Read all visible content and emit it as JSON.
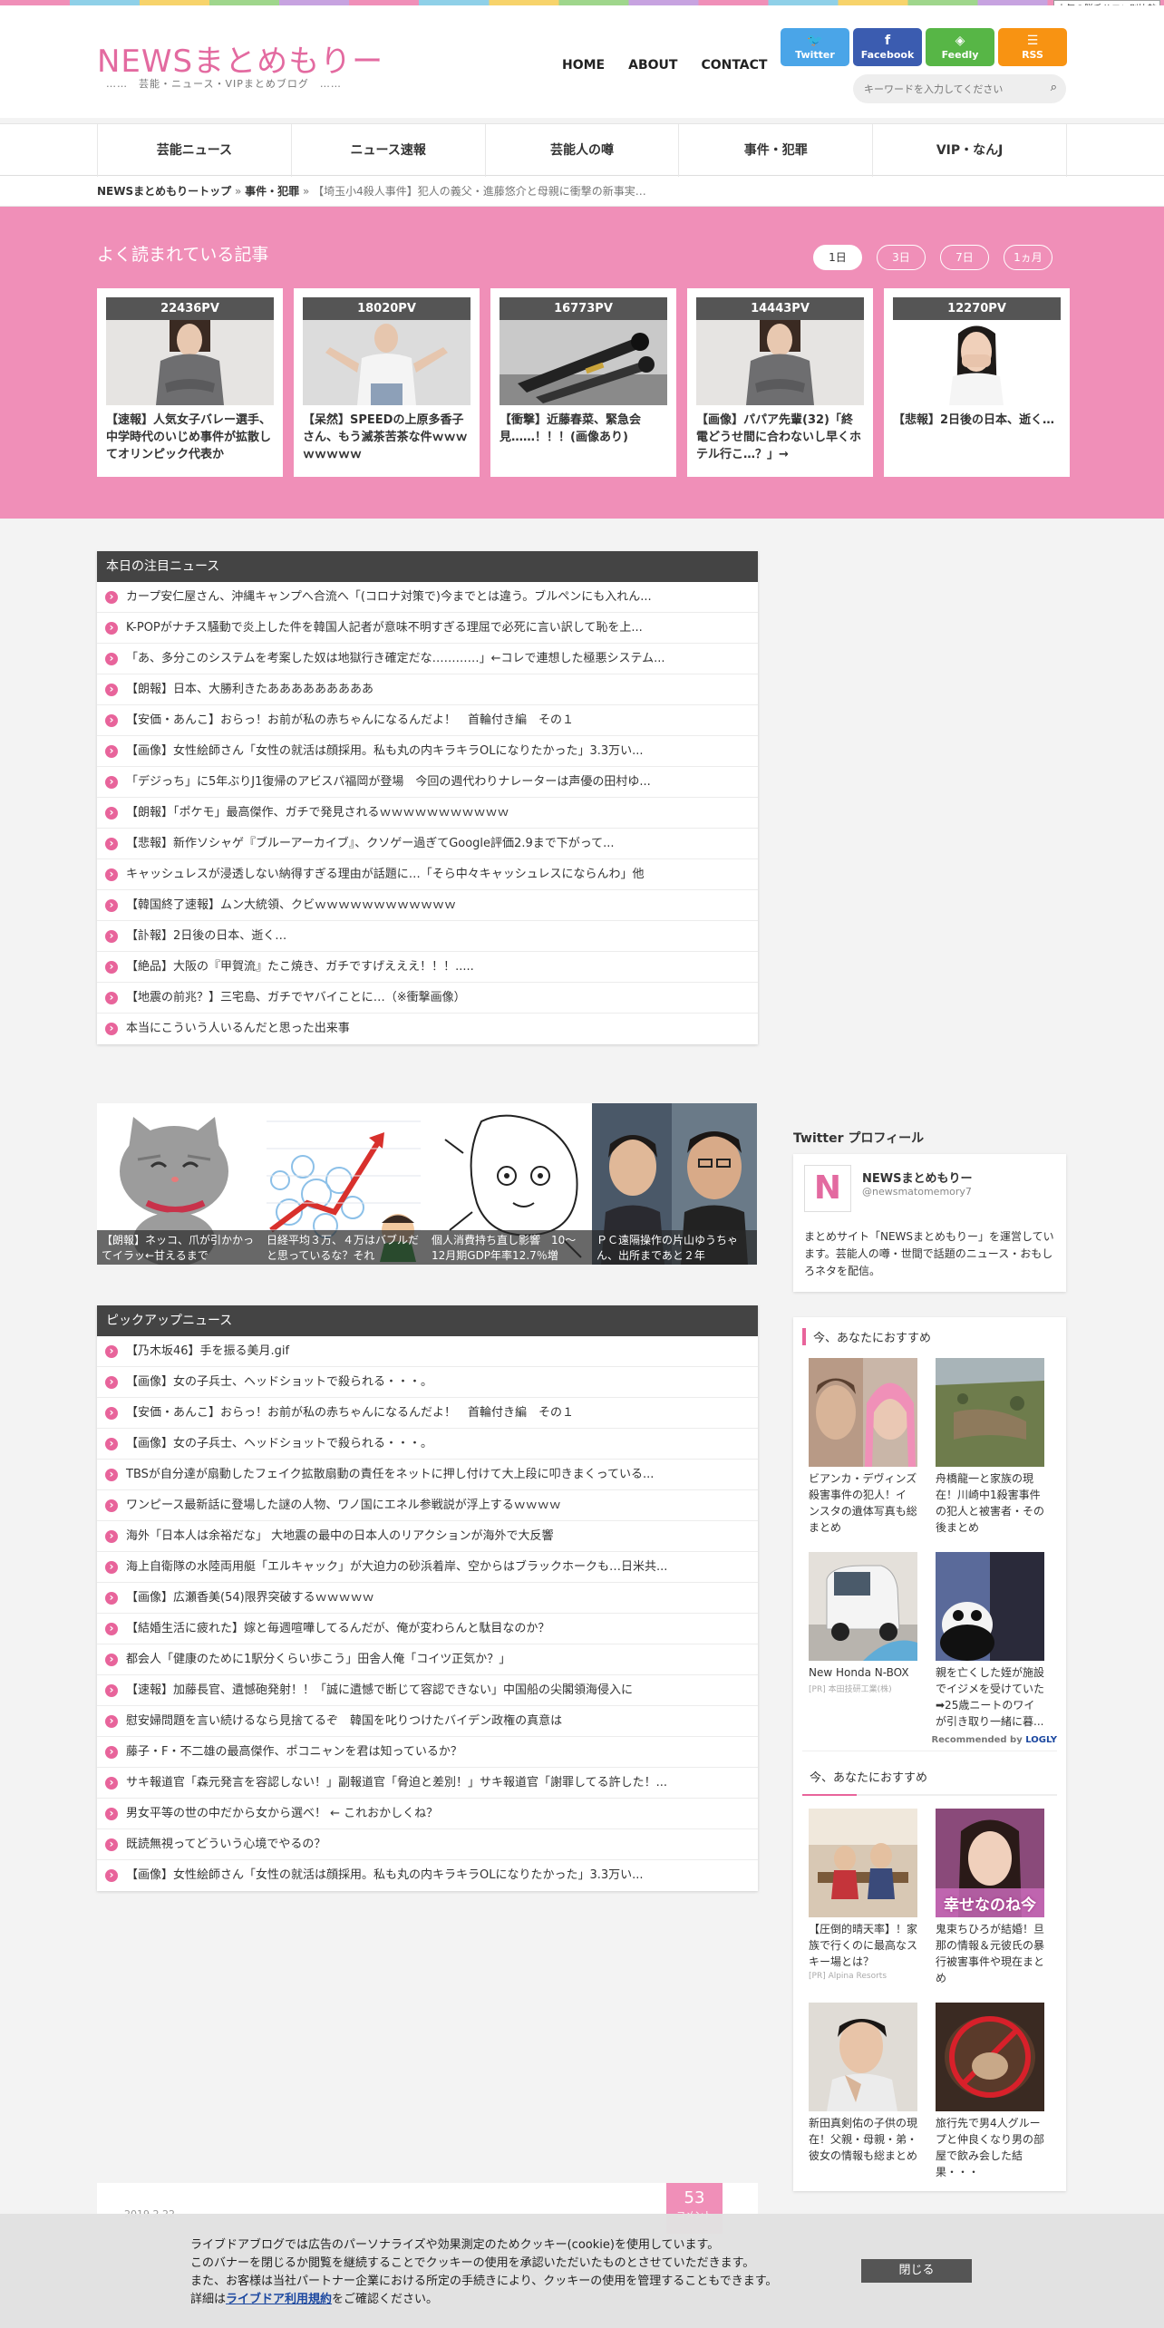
{
  "top_badge": "人気の脱毛サロン別比較",
  "site": {
    "logo": "NEWSまとめもりー",
    "tagline": "……　芸能・ニュース・VIPまとめブログ　……"
  },
  "nav": [
    "HOME",
    "ABOUT",
    "CONTACT"
  ],
  "social": [
    {
      "label": "Twitter",
      "icon": "twitter-icon",
      "glyph": "🐦",
      "color": "#4aa5e8"
    },
    {
      "label": "Facebook",
      "icon": "facebook-icon",
      "glyph": "f",
      "color": "#3b5cb0"
    },
    {
      "label": "Feedly",
      "icon": "feedly-icon",
      "glyph": "◈",
      "color": "#57b646"
    },
    {
      "label": "RSS",
      "icon": "rss-icon",
      "glyph": "☰",
      "color": "#f89312"
    }
  ],
  "search": {
    "placeholder": "キーワードを入力してください"
  },
  "categories": [
    "芸能ニュース",
    "ニュース速報",
    "芸能人の噂",
    "事件・犯罪",
    "VIP・なんJ"
  ],
  "breadcrumb": {
    "home": "NEWSまとめもりートップ",
    "sep": "»",
    "category": "事件・犯罪",
    "current": "【埼玉小4殺人事件】犯人の義父・進藤悠介と母親に衝撃の新事実…"
  },
  "ranking": {
    "title": "よく読まれている記事",
    "tabs": [
      "1日",
      "3日",
      "7日",
      "1ヵ月"
    ],
    "active_tab": 0,
    "cards": [
      {
        "pv": "22436PV",
        "title": "【速報】人気女子バレー選手、中学時代のいじめ事件が拡散してオリンピック代表か",
        "img": "woman"
      },
      {
        "pv": "18020PV",
        "title": "【呆然】SPEEDの上原多香子さん、もう滅茶苦茶な件ｗｗｗｗｗｗｗｗ",
        "img": "shrug"
      },
      {
        "pv": "16773PV",
        "title": "【衝撃】近藤春菜、緊急会見……！！！(画像あり)",
        "img": "mics"
      },
      {
        "pv": "14443PV",
        "title": "【画像】パパア先輩(32)「終電どうせ間に合わないし早くホテル行こ…？」→",
        "img": "woman"
      },
      {
        "pv": "12270PV",
        "title": "【悲報】2日後の日本、逝く…",
        "img": "shock"
      }
    ]
  },
  "today_news": {
    "title": "本日の注目ニュース",
    "items": [
      "カープ安仁屋さん、沖縄キャンプへ合流へ「(コロナ対策で)今までとは違う。ブルペンにも入れん...",
      "K-POPがナチス騒動で炎上した件を韓国人記者が意味不明すぎる理屈で必死に言い訳して恥を上...",
      "「あ、多分このシステムを考案した奴は地獄行き確定だな…………」←コレで連想した極悪システム...",
      "【朗報】日本、大勝利きたあああああああああ",
      "【安価・あんこ】おらっ！お前が私の赤ちゃんになるんだよ！　首輪付き編　その１",
      "【画像】女性絵師さん「女性の就活は顔採用。私も丸の内キラキラOLになりたかった」3.3万い...",
      "「デジっち」に5年ぶりJ1復帰のアビスパ福岡が登場　今回の週代わりナレーターは声優の田村ゆ...",
      "【朗報】「ポケモ」最高傑作、ガチで発見されるｗｗｗｗｗｗｗｗｗｗｗ",
      "【悲報】新作ソシャゲ『ブルーアーカイブ』、クソゲー過ぎてGoogle評価2.9まで下がって...",
      "キャッシュレスが浸透しない納得すぎる理由が話題に…「そら中々キャッシュレスにならんわ」他",
      "【韓国終了速報】ムン大統領、クビｗｗｗｗｗｗｗｗｗｗｗｗ",
      "【訃報】2日後の日本、逝く…",
      "【絶品】大阪の『甲賀流』たこ焼き、ガチですげえええ！！！.....",
      "【地震の前兆？】三宅島、ガチでヤバイことに…（※衝撃画像）",
      "本当にこういう人いるんだと思った出来事"
    ]
  },
  "gallery": [
    {
      "caption": "【朗報】ネッコ、爪が引かかってイラッ←甘えるまで",
      "img": "cat"
    },
    {
      "caption": "日経平均３万、４万はバブルだと思っているな？それ",
      "img": "chart"
    },
    {
      "caption": "個人消費持ち直し影響　10～12月期GDP年率12.7％増",
      "img": "aa"
    },
    {
      "caption": "ＰＣ遠隔操作の片山ゆうちゃん、出所まであと２年",
      "img": "men"
    }
  ],
  "pickup": {
    "title": "ピックアップニュース",
    "items": [
      "【乃木坂46】手を振る美月.gif",
      "【画像】女の子兵士、ヘッドショットで殺られる・・・。",
      "【安価・あんこ】おらっ！お前が私の赤ちゃんになるんだよ！　首輪付き編　その１",
      "【画像】女の子兵士、ヘッドショットで殺られる・・・。",
      "TBSが自分達が扇動したフェイク拡散扇動の責任をネットに押し付けて大上段に叩きまくっている...",
      "ワンピース最新話に登場した謎の人物、ワノ国にエネル参戦説が浮上するｗｗｗｗ",
      "海外「日本人は余裕だな」 大地震の最中の日本人のリアクションが海外で大反響",
      "海上自衛隊の水陸両用艇「エルキャック」が大迫力の砂浜着岸、空からはブラックホークも…日米共...",
      "【画像】広瀬香美(54)限界突破するｗｗｗｗｗ",
      "【結婚生活に疲れた】嫁と毎週喧嘩してるんだが、俺が変わらんと駄目なのか？",
      "都会人「健康のために1駅分くらい歩こう」田舎人俺「コイツ正気か？」",
      "【速報】加藤長官、遺憾砲発射！！「誠に遺憾で断じて容認できない」中国船の尖閣領海侵入に",
      "慰安婦問題を言い続けるなら見捨てるぞ　韓国を叱りつけたバイデン政権の真意は",
      "藤子・F・不二雄の最高傑作、ポコニャンを君は知っているか？",
      "サキ報道官「森元発言を容認しない！」副報道官「脅迫と差別！」サキ報道官「謝罪してる許した！...",
      "男女平等の世の中だから女から選べ！ ← これおかしくね？",
      "既読無視ってどういう心境でやるの？",
      "【画像】女性絵師さん「女性の就活は顔採用。私も丸の内キラキラOLになりたかった」3.3万い..."
    ]
  },
  "post_preview": {
    "date": "2019.2.22",
    "comment_count": "53",
    "comment_label": "コメント"
  },
  "twitter_profile": {
    "heading": "Twitter プロフィール",
    "avatar_letter": "N",
    "name": "NEWSまとめもりー",
    "handle": "@newsmatomemory7",
    "desc": "まとめサイト「NEWSまとめもりー」を運営しています。芸能人の噂・世間で話題のニュース・おもしろネタを配信。"
  },
  "recommend1": {
    "title": "今、あなたにおすすめ",
    "items": [
      {
        "title": "ビアンカ・デヴィンズ殺害事件の犯人！インスタの遺体写真も総まとめ",
        "src": "",
        "img": "faces"
      },
      {
        "title": "舟橋龍一と家族の現在！川崎中1殺害事件の犯人と被害者・その後まとめ",
        "src": "",
        "img": "field"
      },
      {
        "title": "New Honda N-BOX",
        "src": "[PR] 本田技研工業(株)",
        "img": "car"
      },
      {
        "title": "親を亡くした姪が施設でイジメを受けていた➡25歳ニートのワイが引き取り一緒に暮...",
        "src": "",
        "img": "panda"
      }
    ],
    "recommended_by": "Recommended by",
    "logo_text": "LOGLY"
  },
  "recommend2": {
    "title": "今、あなたにおすすめ",
    "items": [
      {
        "title": "【圧倒的晴天率】！家族で行くのに最高なスキー場とは？",
        "src": "[PR] Alpina Resorts",
        "img": "cafe"
      },
      {
        "title": "鬼束ちひろが結婚！旦那の情報＆元彼氏の暴行被害事件や現在まとめ",
        "src": "",
        "img": "singer"
      },
      {
        "title": "新田真剣佑の子供の現在！父親・母親・弟・彼女の情報も総まとめ",
        "src": "",
        "img": "actor"
      },
      {
        "title": "旅行先で男4人グループと仲良くなり男の部屋で飲み会した結果・・・",
        "src": "",
        "img": "cup"
      }
    ],
    "overlay_text": "幸せなのね今"
  },
  "cookie": {
    "line1": "ライブドアブログでは広告のパーソナライズや効果測定のためクッキー(cookie)を使用しています。",
    "line2": "このバナーを閉じるか閲覧を継続することでクッキーの使用を承認いただいたものとさせていただきます。",
    "line3": "また、お客様は当社パートナー企業における所定の手続きにより、クッキーの使用を管理することもできます。",
    "line4_pre": "詳細は",
    "link": "ライブドア利用規約",
    "line4_post": "をご確認ください。",
    "close": "閉じる"
  },
  "colors": {
    "accent": "#e8649b",
    "ranking_bg": "#f08fb8",
    "header_bar": "#444444"
  }
}
